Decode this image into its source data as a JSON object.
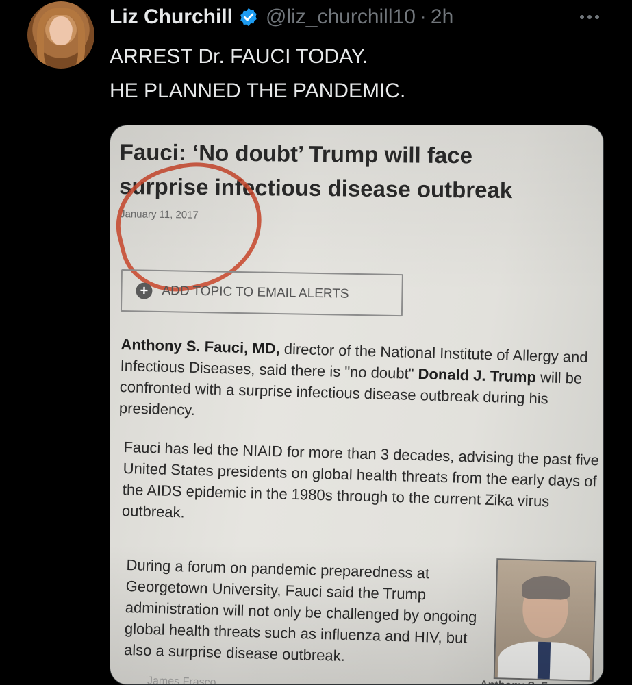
{
  "tweet": {
    "author_name": "Liz Churchill",
    "handle": "@liz_churchill10",
    "separator": "·",
    "time": "2h",
    "text_lines": [
      "ARREST Dr. FAUCI TODAY.",
      "HE PLANNED THE PANDEMIC."
    ],
    "verified_color": "#1d9bf0"
  },
  "media": {
    "headline_line1": "Fauci: ‘No doubt’ Trump will face",
    "headline_line2": "surprise infectious disease outbreak",
    "date": "January 11, 2017",
    "alert_button": "ADD TOPIC TO EMAIL ALERTS",
    "p1_name": "Anthony S. Fauci, MD,",
    "p1_text_a": " director of the National Institute of Allergy and Infectious Diseases, said there is \"no doubt\" ",
    "p1_name2": "Donald J. Trump",
    "p1_text_b": " will be confronted with a surprise infectious disease outbreak during his presidency.",
    "p2": "Fauci has led the NIAID for more than 3 decades, advising the past five United States presidents on global health threats from the early days of the AIDS epidemic in the 1980s through to the current Zika virus outbreak.",
    "p3": "During a forum on pandemic preparedness at Georgetown University, Fauci said the Trump administration will not only be challenged by ongoing global health threats such as influenza and HIV, but also a surprise disease outbreak.",
    "caption_left": "James Frasco...",
    "caption_right": "Anthony S. Fau..."
  }
}
